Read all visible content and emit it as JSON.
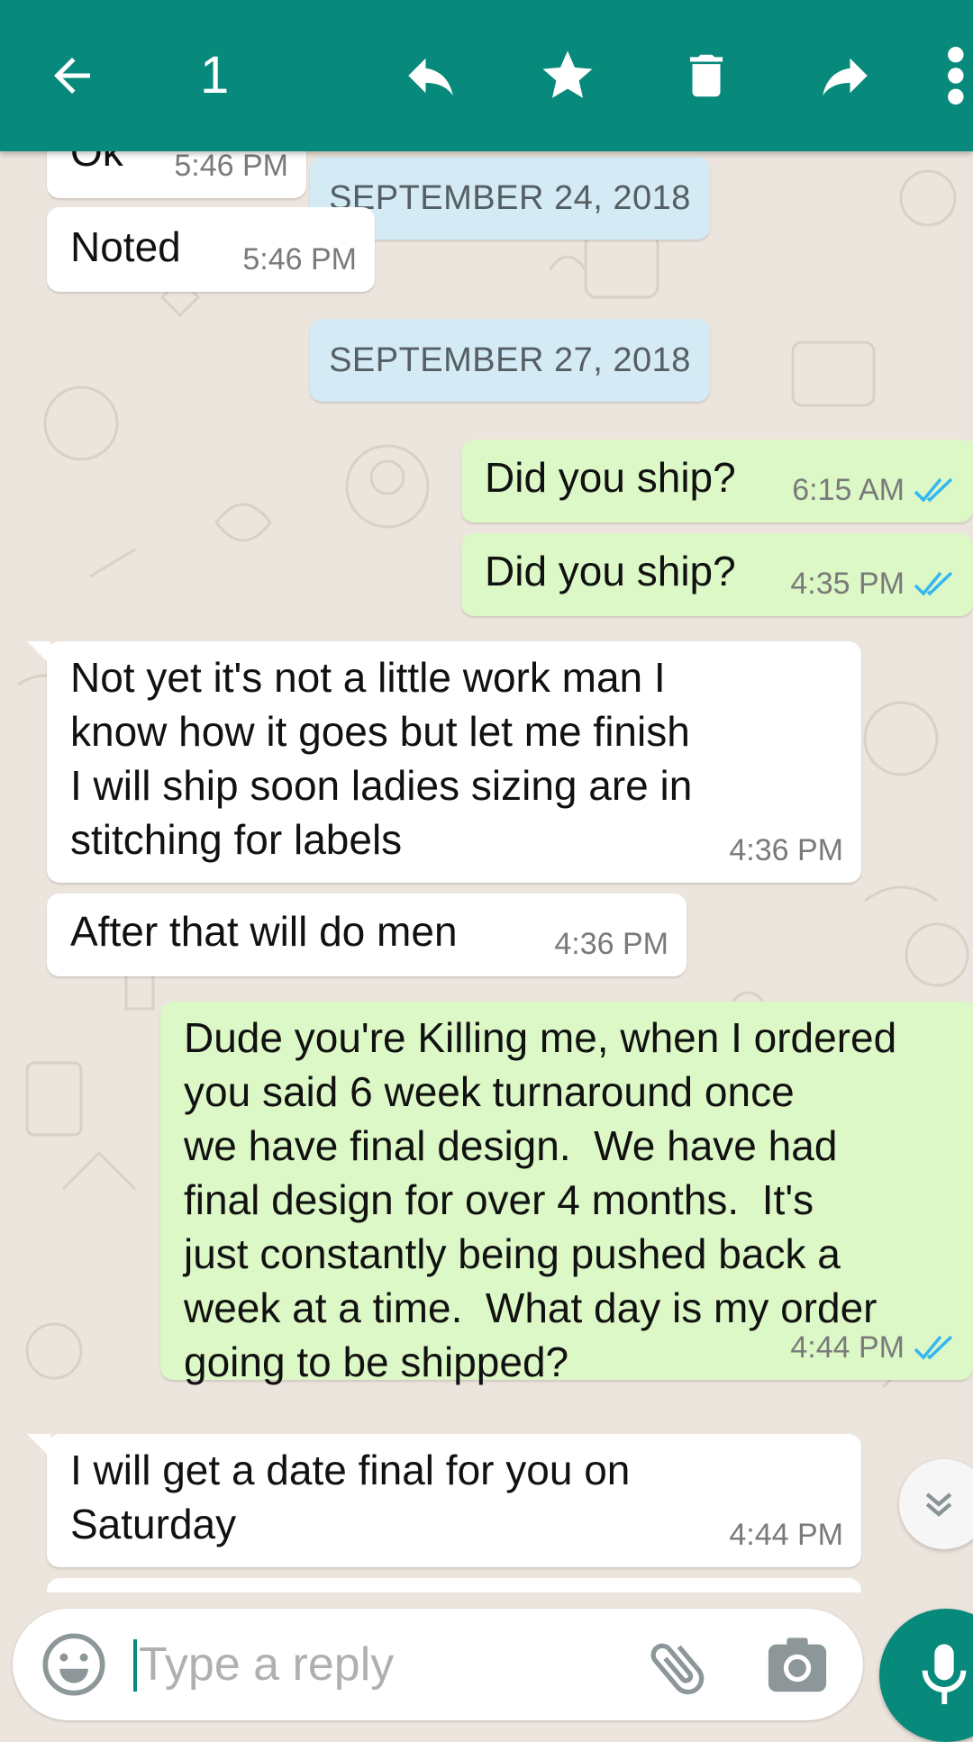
{
  "topbar": {
    "selected_count": "1",
    "icons": [
      "back-arrow-icon",
      "reply-icon",
      "star-icon",
      "delete-icon",
      "forward-icon",
      "more-vert-icon"
    ]
  },
  "messages": [
    {
      "id": "m0",
      "direction": "in",
      "text": "Ok",
      "time": "5:46 PM"
    },
    {
      "id": "d1",
      "type": "date",
      "text": "SEPTEMBER 24, 2018"
    },
    {
      "id": "m1",
      "direction": "in",
      "text": "Noted",
      "time": "5:46 PM"
    },
    {
      "id": "d2",
      "type": "date",
      "text": "SEPTEMBER 27, 2018"
    },
    {
      "id": "m2",
      "direction": "out",
      "text": "Did you ship?",
      "time": "6:15 AM",
      "read": true
    },
    {
      "id": "m3",
      "direction": "out",
      "text": "Did you ship?",
      "time": "4:35 PM",
      "read": true
    },
    {
      "id": "m4",
      "direction": "in",
      "text": "Not yet it's not a little work man I\nknow how it goes but let me finish\nI will ship soon ladies sizing are in\nstitching for labels",
      "time": "4:36 PM"
    },
    {
      "id": "m5",
      "direction": "in",
      "text": "After that will do men",
      "time": "4:36 PM"
    },
    {
      "id": "m6",
      "direction": "out",
      "text": "Dude you're Killing me, when I ordered\nyou said 6 week turnaround once\nwe have final design.  We have had\nfinal design for over 4 months.  It's\njust constantly being pushed back a\nweek at a time.  What day is my order\ngoing to be shipped?",
      "time": "4:44 PM",
      "read": true
    },
    {
      "id": "m7",
      "direction": "in",
      "text": "I will get a date final for you on\nSaturday",
      "time": "4:44 PM"
    }
  ],
  "input": {
    "placeholder": "Type a reply"
  },
  "colors": {
    "header": "#07897b",
    "outgoing_bubble": "#dcf8c6",
    "incoming_bubble": "#ffffff",
    "date_chip": "#d4eaf4",
    "read_ticks": "#34b7f1",
    "background": "#ece5dd"
  }
}
